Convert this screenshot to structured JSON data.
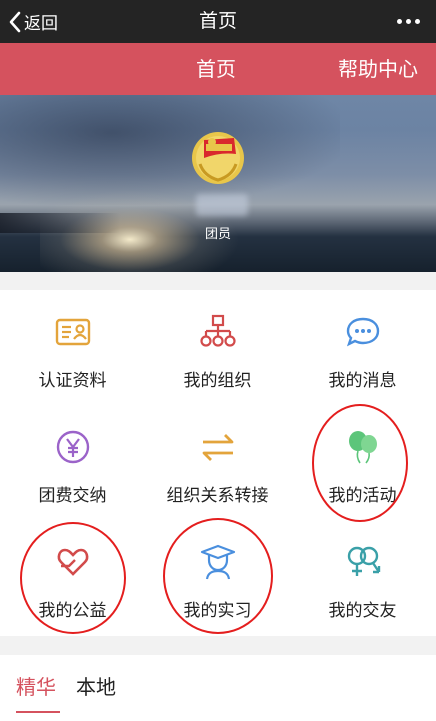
{
  "topbar": {
    "back_label": "返回",
    "title": "首页"
  },
  "nav": {
    "home": "首页",
    "help": "帮助中心"
  },
  "profile": {
    "role": "团员"
  },
  "menu": [
    {
      "label": "认证资料",
      "icon": "id-card-icon",
      "color": "#e3a43b"
    },
    {
      "label": "我的组织",
      "icon": "org-chart-icon",
      "color": "#d24b4b"
    },
    {
      "label": "我的消息",
      "icon": "message-bubble-icon",
      "color": "#4a8fde"
    },
    {
      "label": "团费交纳",
      "icon": "yen-coin-icon",
      "color": "#9b63c9"
    },
    {
      "label": "组织关系转接",
      "icon": "transfer-arrows-icon",
      "color": "#e3a43b"
    },
    {
      "label": "我的活动",
      "icon": "balloons-icon",
      "color": "#5cc57a"
    },
    {
      "label": "我的公益",
      "icon": "heart-hand-icon",
      "color": "#d24b4b"
    },
    {
      "label": "我的实习",
      "icon": "graduate-icon",
      "color": "#4a8fde"
    },
    {
      "label": "我的交友",
      "icon": "gender-symbols-icon",
      "color": "#3aa0a8"
    }
  ],
  "tabs": [
    {
      "label": "精华"
    },
    {
      "label": "本地"
    }
  ],
  "colors": {
    "accent": "#d5525e",
    "annotation": "#e41e1e"
  }
}
